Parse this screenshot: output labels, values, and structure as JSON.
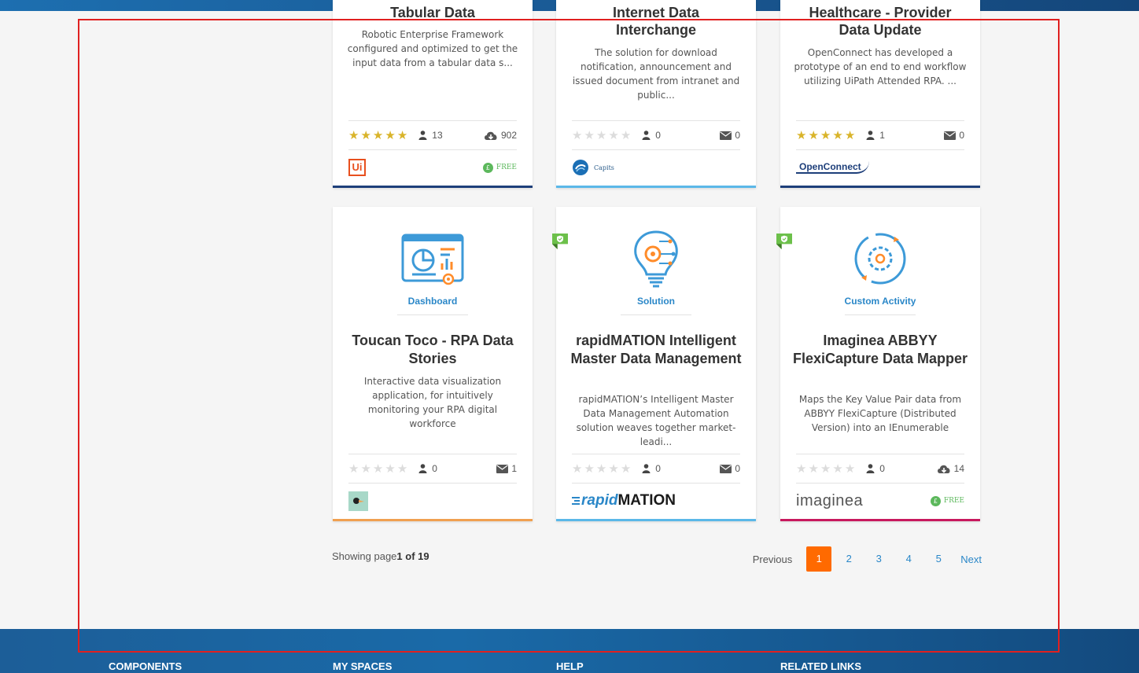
{
  "cards_row1": [
    {
      "title_line": "Tabular Data",
      "description": "Robotic Enterprise Framework configured and optimized to get the input data from a tabular data s...",
      "stars": 5,
      "users": "13",
      "right_value": "902",
      "right_icon": "cloud-download-icon",
      "publisher_logo_text": "Ui",
      "free_label": "FREE",
      "accent": "#1e3f7a"
    },
    {
      "title_line1": "Internet Data",
      "title_line2": "Interchange",
      "description": "The solution for download notification, announcement and issued document from intranet and public...",
      "stars": 0,
      "users": "0",
      "right_value": "0",
      "right_icon": "envelope-icon",
      "publisher_logo_text": "Capits",
      "accent": "#5bb8e8"
    },
    {
      "title_line1": "Healthcare - Provider",
      "title_line2": "Data Update",
      "description": "OpenConnect has developed a prototype of an end to end workflow utilizing UiPath Attended RPA. ...",
      "stars": 5,
      "users": "1",
      "right_value": "0",
      "right_icon": "envelope-icon",
      "publisher_logo_text": "OpenConnect",
      "accent": "#1e3f7a"
    }
  ],
  "cards_row2": [
    {
      "category": "Dashboard",
      "title": "Toucan Toco - RPA Data Stories",
      "description": "Interactive data visualization application, for intuitively monitoring your RPA digital workforce",
      "stars": 0,
      "users": "0",
      "right_value": "1",
      "right_icon": "envelope-icon",
      "accent": "#f0a050"
    },
    {
      "category": "Solution",
      "title": "rapidMATION Intelligent Master Data Management",
      "description": "rapidMATION’s Intelligent Master Data Management Automation solution weaves together market-leadi...",
      "stars": 0,
      "users": "0",
      "right_value": "0",
      "right_icon": "envelope-icon",
      "logo_part1": "rapid",
      "logo_part2": "MATION",
      "accent": "#5bb8e8"
    },
    {
      "category": "Custom Activity",
      "title": "Imaginea ABBYY FlexiCapture Data Mapper",
      "description": "Maps the Key Value Pair data from ABBYY FlexiCapture (Distributed Version) into an IEnumerable",
      "stars": 0,
      "users": "0",
      "right_value": "14",
      "right_icon": "cloud-download-icon",
      "logo_text": "imaginea",
      "free_label": "FREE",
      "accent": "#c8195e"
    }
  ],
  "pagination": {
    "showing_prefix": "Showing page",
    "showing_value": "1 of 19",
    "previous": "Previous",
    "pages": [
      "1",
      "2",
      "3",
      "4",
      "5"
    ],
    "next": "Next"
  },
  "footer": {
    "components": "COMPONENTS",
    "my_spaces": "MY SPACES",
    "help": "HELP",
    "related_links": "RELATED LINKS"
  },
  "colors": {
    "accent_orange": "#ff6a00",
    "link_blue": "#2a87c8",
    "star_gold": "#d9b42a",
    "certified_green": "#6cc04a"
  }
}
